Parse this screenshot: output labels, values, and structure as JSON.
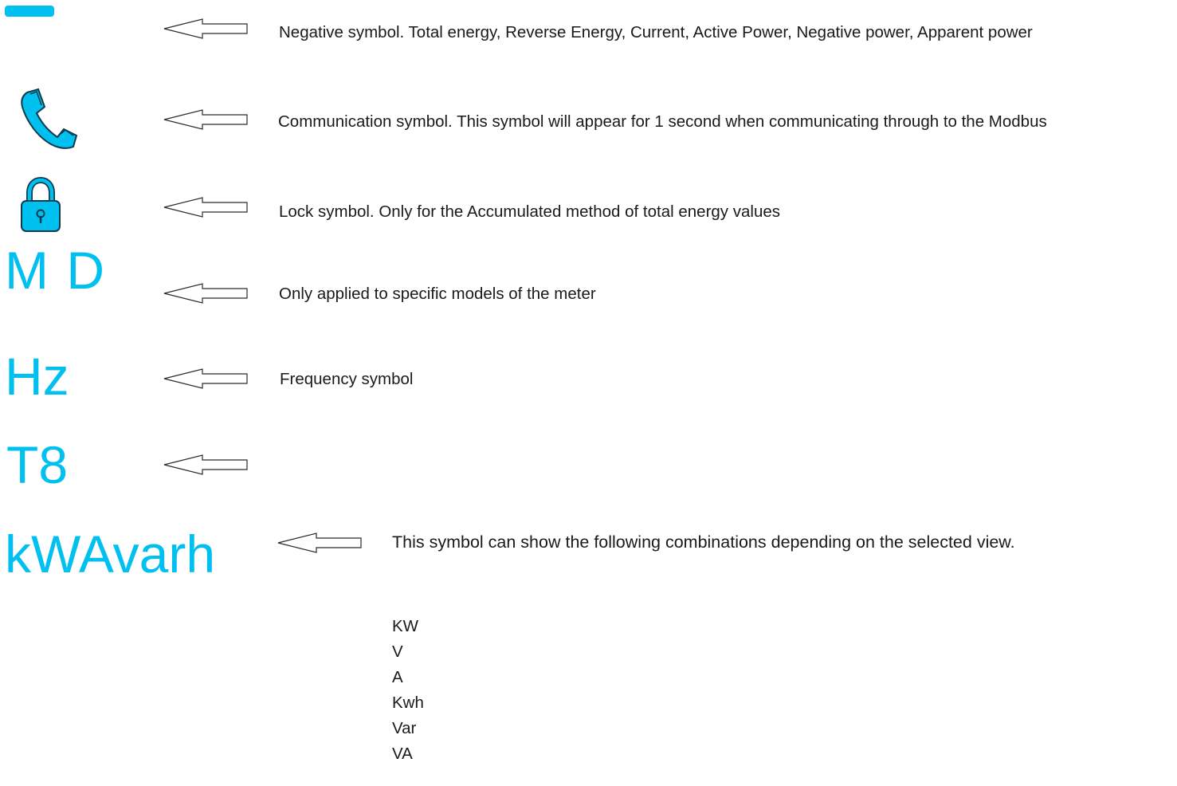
{
  "colors": {
    "accent": "#00C0F0",
    "accent_dark": "#0E3B4C",
    "text": "#1a1a1a",
    "arrow_stroke": "#2a2a2a"
  },
  "legend": [
    {
      "symbol_type": "minus-bar",
      "icon": "minus-icon",
      "description": "Negative symbol.  Total energy, Reverse Energy, Current, Active Power, Negative power, Apparent power"
    },
    {
      "symbol_type": "phone-icon",
      "icon": "phone-icon",
      "description": "Communication symbol.  This symbol will appear for 1 second when communicating through to the Modbus"
    },
    {
      "symbol_type": "lock-icon",
      "icon": "lock-icon",
      "description": "Lock symbol.  Only for the Accumulated method of total energy values"
    },
    {
      "symbol_type": "text",
      "symbol_text": "M D",
      "description": "Only applied to specific models of the meter"
    },
    {
      "symbol_type": "text",
      "symbol_text": "Hz",
      "description": "Frequency symbol"
    },
    {
      "symbol_type": "text",
      "symbol_text": "T8",
      "description": ""
    },
    {
      "symbol_type": "text",
      "symbol_text": "kWAvarh",
      "description": "This symbol can show the following combinations depending on the selected view."
    }
  ],
  "combinations": [
    "KW",
    "V",
    "A",
    "Kwh",
    "Var",
    "VA"
  ]
}
